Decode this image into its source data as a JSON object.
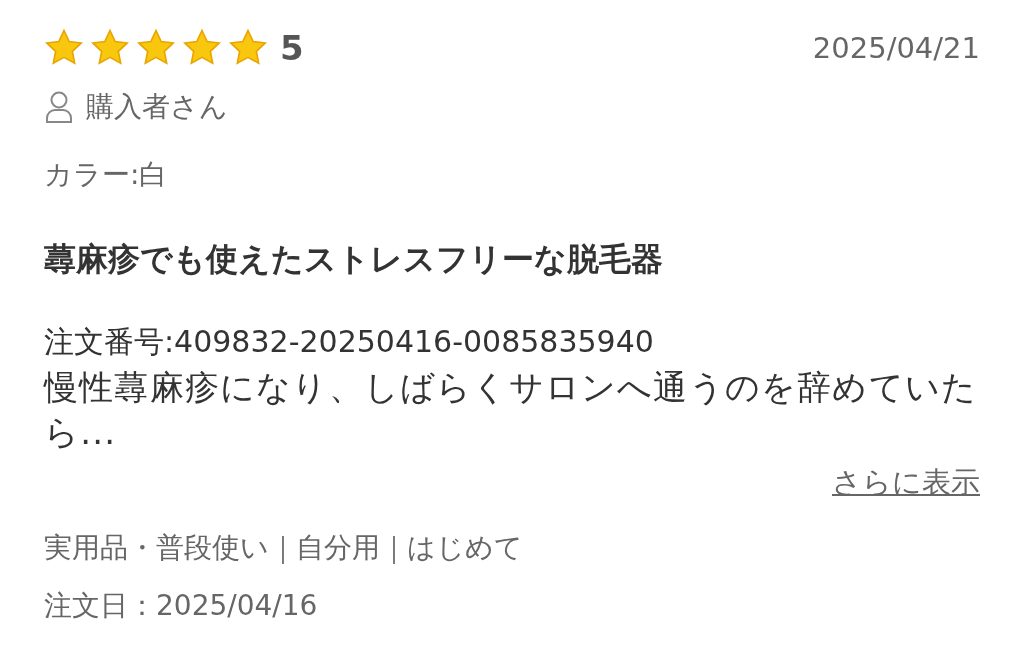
{
  "review": {
    "stars": 5,
    "rating": "5",
    "date": "2025/04/21",
    "reviewer": "購入者さん",
    "variant": "カラー:白",
    "title": "蕁麻疹でも使えたストレスフリーな脱毛器",
    "order_number": "注文番号:409832-20250416-0085835940",
    "body": "慢性蕁麻疹になり、しばらくサロンへ通うのを辞めていたら...",
    "more_link": "さらに表示",
    "tags": "実用品・普段使い｜自分用｜はじめて",
    "order_date": "注文日：2025/04/16"
  }
}
